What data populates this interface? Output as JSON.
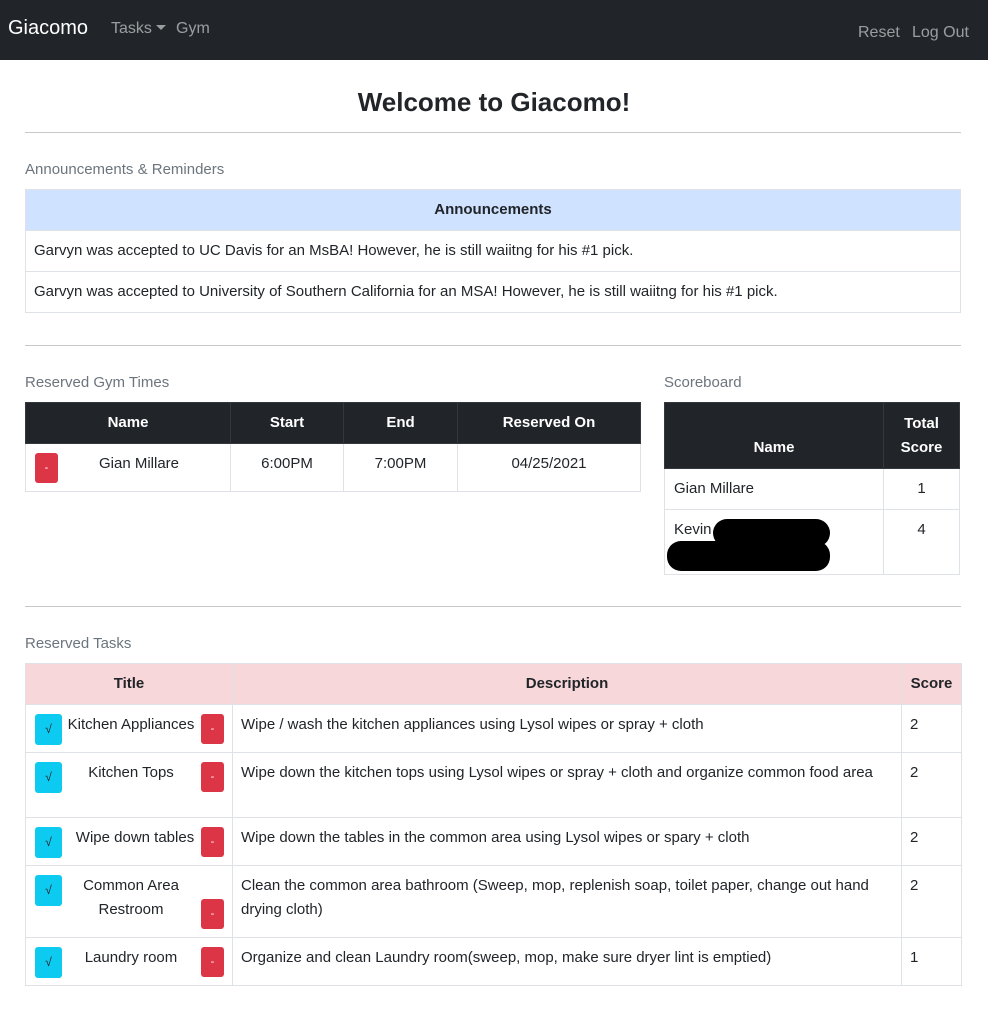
{
  "navbar": {
    "brand": "Giacomo",
    "tasks": "Tasks",
    "gym": "Gym",
    "reset": "Reset",
    "logout": "Log Out"
  },
  "page": {
    "title": "Welcome to Giacomo!"
  },
  "announcements": {
    "section_label": "Announcements & Reminders",
    "header": "Announcements",
    "items": [
      "Garvyn was accepted to UC Davis for an MsBA! However, he is still waiitng for his #1 pick.",
      "Garvyn was accepted to University of Southern California for an MSA! However, he is still waiitng for his #1 pick."
    ]
  },
  "gym": {
    "section_label": "Reserved Gym Times",
    "columns": [
      "Name",
      "Start",
      "End",
      "Reserved On"
    ],
    "rows": [
      {
        "remove": "-",
        "name": "Gian Millare",
        "start": "6:00PM",
        "end": "7:00PM",
        "reserved_on": "04/25/2021"
      }
    ]
  },
  "scoreboard": {
    "section_label": "Scoreboard",
    "columns": [
      "Name",
      "Total Score"
    ],
    "rows": [
      {
        "name": "Gian Millare",
        "score": "1"
      },
      {
        "name": "Kevin",
        "score": "4"
      }
    ]
  },
  "tasks": {
    "section_label": "Reserved Tasks",
    "columns": [
      "Title",
      "Description",
      "Score"
    ],
    "complete_label": "√",
    "remove_label": "-",
    "rows": [
      {
        "title": "Kitchen Appliances",
        "description": "Wipe / wash the kitchen appliances using Lysol wipes or spray + cloth",
        "score": "2"
      },
      {
        "title": "Kitchen Tops",
        "description": "Wipe down the kitchen tops using Lysol wipes or spray + cloth and organize common food area",
        "score": "2"
      },
      {
        "title": "Wipe down tables",
        "description": "Wipe down the tables in the common area using Lysol wipes or spary + cloth",
        "score": "2"
      },
      {
        "title": "Common Area Restroom",
        "description": "Clean the common area bathroom (Sweep, mop, replenish soap, toilet paper, change out hand drying cloth)",
        "score": "2"
      },
      {
        "title": "Laundry room",
        "description": "Organize and clean Laundry room(sweep, mop, make sure dryer lint is emptied)",
        "score": "1"
      }
    ]
  },
  "colors": {
    "navbar_bg": "#212529",
    "announcement_header": "#cfe2ff",
    "task_header": "#f8d7da",
    "danger": "#dc3545",
    "info": "#0dcaf0"
  }
}
